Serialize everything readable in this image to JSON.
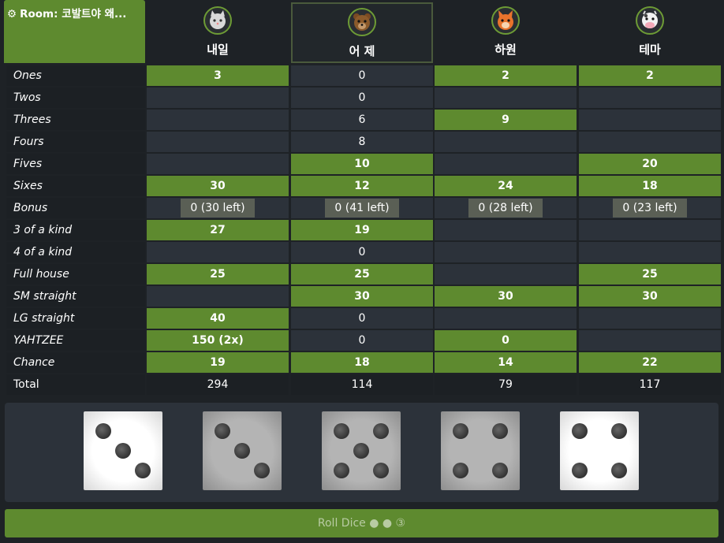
{
  "room": {
    "label": "Room: 코발트야 왜...",
    "icon": "gear-icon"
  },
  "players": [
    {
      "name": "내일",
      "avatar": "cat"
    },
    {
      "name": "어 제",
      "avatar": "bear"
    },
    {
      "name": "하원",
      "avatar": "squirrel"
    },
    {
      "name": "테마",
      "avatar": "cow"
    }
  ],
  "categories": [
    "Ones",
    "Twos",
    "Threes",
    "Fours",
    "Fives",
    "Sixes",
    "Bonus",
    "3 of a kind",
    "4 of a kind",
    "Full house",
    "SM straight",
    "LG straight",
    "YAHTZEE",
    "Chance",
    "Total"
  ],
  "scores": [
    [
      {
        "v": "3",
        "g": true
      },
      {
        "v": "0",
        "g": false
      },
      {
        "v": "2",
        "g": true
      },
      {
        "v": "2",
        "g": true
      }
    ],
    [
      {
        "v": "",
        "g": false
      },
      {
        "v": "0",
        "g": false
      },
      {
        "v": "",
        "g": false
      },
      {
        "v": "",
        "g": false
      }
    ],
    [
      {
        "v": "",
        "g": false
      },
      {
        "v": "6",
        "g": false
      },
      {
        "v": "9",
        "g": true
      },
      {
        "v": "",
        "g": false
      }
    ],
    [
      {
        "v": "",
        "g": false
      },
      {
        "v": "8",
        "g": false
      },
      {
        "v": "",
        "g": false
      },
      {
        "v": "",
        "g": false
      }
    ],
    [
      {
        "v": "",
        "g": false
      },
      {
        "v": "10",
        "g": true
      },
      {
        "v": "",
        "g": false
      },
      {
        "v": "20",
        "g": true
      }
    ],
    [
      {
        "v": "30",
        "g": true
      },
      {
        "v": "12",
        "g": true
      },
      {
        "v": "24",
        "g": true
      },
      {
        "v": "18",
        "g": true
      }
    ],
    [
      {
        "v": "0 (30 left)",
        "b": true
      },
      {
        "v": "0 (41 left)",
        "b": true
      },
      {
        "v": "0 (28 left)",
        "b": true
      },
      {
        "v": "0 (23 left)",
        "b": true
      }
    ],
    [
      {
        "v": "27",
        "g": true
      },
      {
        "v": "19",
        "g": true
      },
      {
        "v": "",
        "g": false
      },
      {
        "v": "",
        "g": false
      }
    ],
    [
      {
        "v": "",
        "g": false
      },
      {
        "v": "0",
        "g": false
      },
      {
        "v": "",
        "g": false
      },
      {
        "v": "",
        "g": false
      }
    ],
    [
      {
        "v": "25",
        "g": true
      },
      {
        "v": "25",
        "g": true
      },
      {
        "v": "",
        "g": false
      },
      {
        "v": "25",
        "g": true
      }
    ],
    [
      {
        "v": "",
        "g": false
      },
      {
        "v": "30",
        "g": true
      },
      {
        "v": "30",
        "g": true
      },
      {
        "v": "30",
        "g": true
      }
    ],
    [
      {
        "v": "40",
        "g": true
      },
      {
        "v": "0",
        "g": false
      },
      {
        "v": "",
        "g": false
      },
      {
        "v": "",
        "g": false
      }
    ],
    [
      {
        "v": "150 (2x)",
        "g": true
      },
      {
        "v": "0",
        "g": false
      },
      {
        "v": "0",
        "g": true
      },
      {
        "v": "",
        "g": false
      }
    ],
    [
      {
        "v": "19",
        "g": true
      },
      {
        "v": "18",
        "g": true
      },
      {
        "v": "14",
        "g": true
      },
      {
        "v": "22",
        "g": true
      }
    ],
    [
      {
        "v": "294",
        "t": true
      },
      {
        "v": "114",
        "t": true
      },
      {
        "v": "79",
        "t": true
      },
      {
        "v": "117",
        "t": true
      }
    ]
  ],
  "dice": [
    {
      "value": 3,
      "held": false
    },
    {
      "value": 3,
      "held": true
    },
    {
      "value": 5,
      "held": true
    },
    {
      "value": 4,
      "held": true
    },
    {
      "value": 4,
      "held": false
    }
  ],
  "roll_button": {
    "label": "Roll Dice ● ● ③"
  },
  "colors": {
    "green": "#5e8a2f",
    "cell": "#2c323a",
    "bg": "#1e2226"
  }
}
